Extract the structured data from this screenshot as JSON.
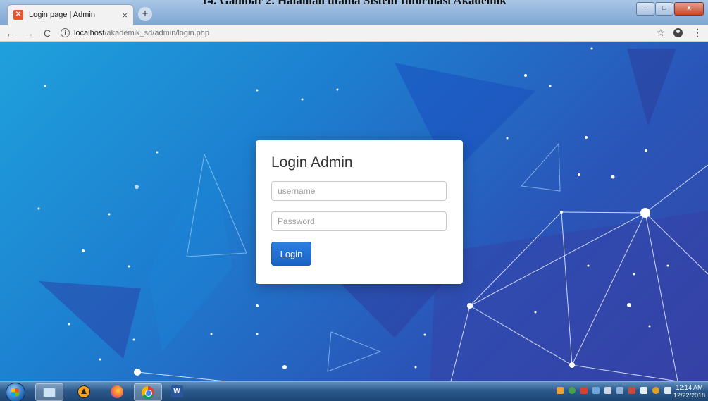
{
  "document": {
    "caption": "14. Gambar 2. Halaman utama Sistem Informasi Akademik"
  },
  "browser": {
    "tab": {
      "title": "Login page | Admin",
      "favicon": "xampp-icon"
    },
    "new_tab_symbol": "+",
    "url": {
      "host": "localhost",
      "path": "/akademik_sd/admin/login.php"
    },
    "window_controls": {
      "minimize": "–",
      "maximize": "□",
      "close": "x"
    }
  },
  "login": {
    "title": "Login Admin",
    "username_placeholder": "username",
    "password_placeholder": "Password",
    "button_label": "Login"
  },
  "colors": {
    "background_start": "#1fa1dc",
    "background_end": "#3545a8",
    "button": "#1a63c4",
    "card": "#ffffff"
  },
  "taskbar": {
    "apps": [
      "network-icon",
      "avast-icon",
      "firefox-icon",
      "chrome-icon",
      "word-icon"
    ],
    "clock": {
      "time": "12:14 AM",
      "date": "12/22/2018"
    }
  }
}
